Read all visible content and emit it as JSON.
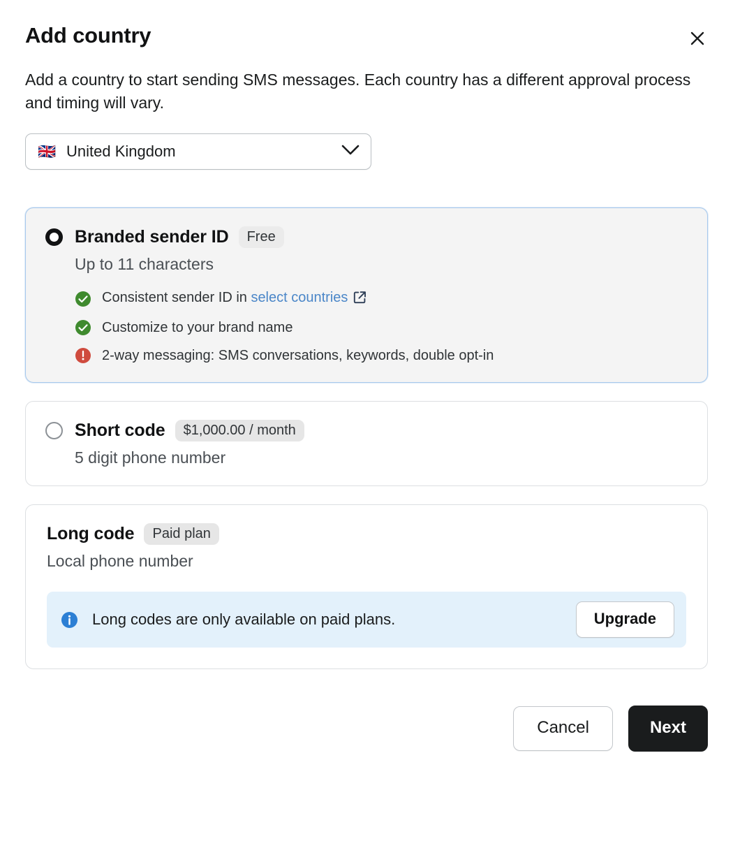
{
  "modal": {
    "title": "Add country",
    "close_icon": "close-icon",
    "description": "Add a country to start sending SMS messages. Each country has a different approval process and timing will vary."
  },
  "country_select": {
    "name": "country-select",
    "flag": "🇬🇧",
    "value": "United Kingdom",
    "chevron_icon": "chevron-down-icon"
  },
  "options": [
    {
      "id": "branded-sender-id",
      "title": "Branded sender ID",
      "badge": "Free",
      "subtitle": "Up to 11 characters",
      "selected": true,
      "features": [
        {
          "status": "check",
          "text_before": "Consistent sender ID in ",
          "link_text": "select countries",
          "text_after": "",
          "external_icon": "external-link-icon"
        },
        {
          "status": "check",
          "text_before": "Customize to your brand name",
          "link_text": "",
          "text_after": ""
        },
        {
          "status": "alert",
          "text_before": "2-way messaging: SMS conversations, keywords, double opt-in",
          "link_text": "",
          "text_after": ""
        }
      ]
    },
    {
      "id": "short-code",
      "title": "Short code",
      "badge": "$1,000.00 / month",
      "subtitle": "5 digit phone number",
      "selected": false
    },
    {
      "id": "long-code",
      "title": "Long code",
      "badge": "Paid plan",
      "subtitle": "Local phone number",
      "selected": false,
      "banner": {
        "icon": "info-icon",
        "text": "Long codes are only available on paid plans.",
        "button_label": "Upgrade"
      }
    }
  ],
  "footer": {
    "cancel_label": "Cancel",
    "next_label": "Next"
  },
  "colors": {
    "accent_selected_border": "#a8c9ec",
    "selected_card_bg": "#f4f4f4",
    "check_green": "#3f8a2e",
    "alert_red": "#cf4b3e",
    "info_blue": "#2c7fd4",
    "banner_bg": "#e3f1fb",
    "link_blue": "#4a86c8",
    "primary_button_bg": "#1a1c1d"
  }
}
